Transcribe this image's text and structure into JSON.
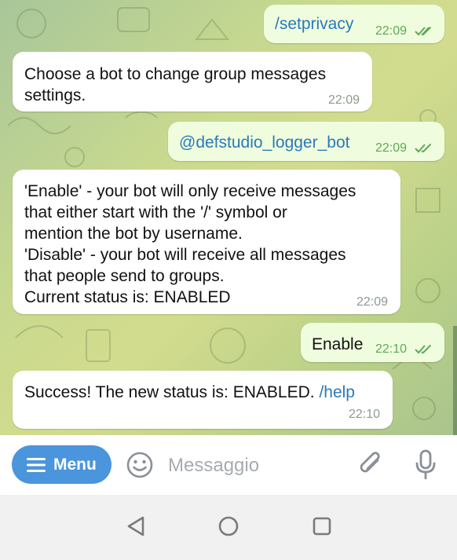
{
  "messages": [
    {
      "direction": "outgoing",
      "text": "/setprivacy",
      "time": "22:09",
      "read": true
    },
    {
      "direction": "incoming",
      "lines": [
        "Choose a bot to change group messages",
        "settings."
      ],
      "time": "22:09"
    },
    {
      "direction": "outgoing",
      "text": "@defstudio_logger_bot",
      "time": "22:09",
      "read": true
    },
    {
      "direction": "incoming",
      "lines": [
        "'Enable' - your bot will only receive messages",
        "that either start with the '/' symbol or",
        "mention the bot by username.",
        "'Disable' - your bot will receive all messages",
        "that people send to groups.",
        "Current status is: ENABLED"
      ],
      "time": "22:09"
    },
    {
      "direction": "outgoing",
      "text": "Enable",
      "time": "22:10",
      "read": true
    },
    {
      "direction": "incoming",
      "text": "Success! The new status is: ENABLED. ",
      "link": "/help",
      "time": "22:10"
    }
  ],
  "input_bar": {
    "menu_label": "Menu",
    "placeholder": "Messaggio",
    "icons": [
      "menu-lines-icon",
      "emoji-icon",
      "attach-icon",
      "microphone-icon"
    ]
  },
  "navigation_bar": {
    "icons": [
      "back-triangle-icon",
      "home-circle-icon",
      "recents-square-icon"
    ]
  },
  "colors": {
    "outgoing_bubble": "#effdde",
    "incoming_bubble": "#ffffff",
    "link": "#2a7ab8",
    "menu_button": "#4a95dc",
    "check_marks": "#5fa85a"
  }
}
